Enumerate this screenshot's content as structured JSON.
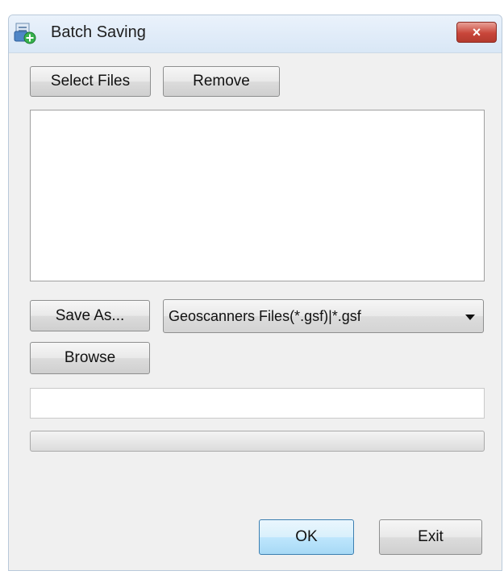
{
  "window": {
    "title": "Batch Saving",
    "close_label": "×"
  },
  "buttons": {
    "select_files": "Select Files",
    "remove": "Remove",
    "save_as": "Save As...",
    "browse": "Browse",
    "ok": "OK",
    "exit": "Exit"
  },
  "file_list": {
    "items": []
  },
  "format_select": {
    "selected": "Geoscanners Files(*.gsf)|*.gsf"
  },
  "path_field": {
    "value": ""
  },
  "progress": {
    "value": 0
  },
  "icons": {
    "app": "batch-save-icon",
    "close": "close-icon",
    "dropdown": "chevron-down-icon"
  }
}
